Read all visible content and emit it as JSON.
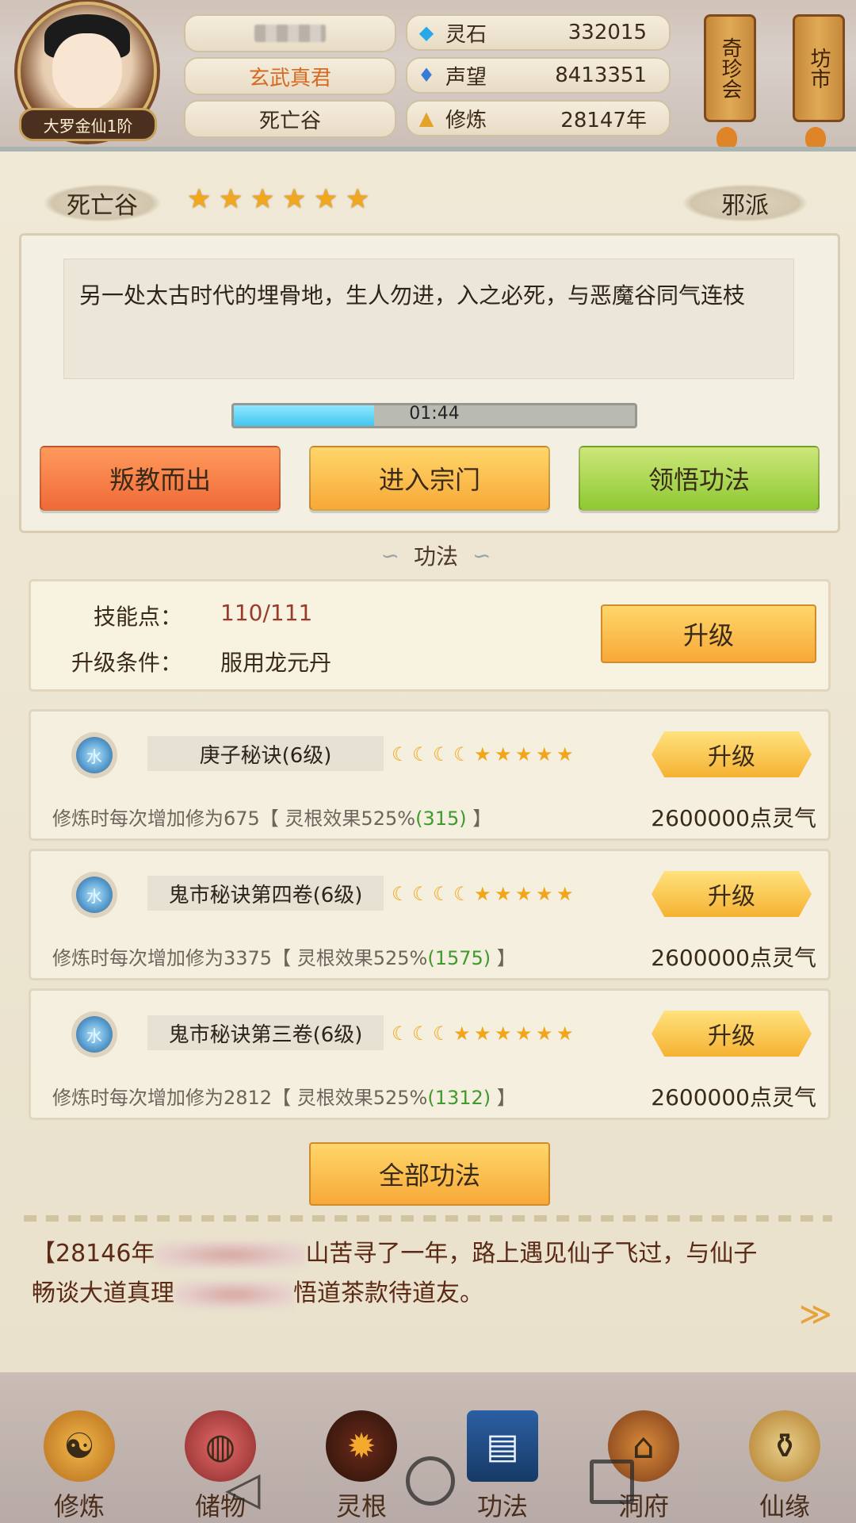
{
  "header": {
    "rank_badge": "大罗金仙1阶",
    "title": "玄武真君",
    "sect": "死亡谷",
    "resources": [
      {
        "icon": "spirit-stone-icon",
        "label": "灵石",
        "value": "332015"
      },
      {
        "icon": "reputation-crystal-icon",
        "label": "声望",
        "value": "8413351"
      },
      {
        "icon": "meditation-icon",
        "label": "修炼",
        "value": "28147年"
      }
    ],
    "lanterns": [
      {
        "label": "奇珍会"
      },
      {
        "label": "坊市"
      }
    ]
  },
  "sect_info": {
    "name": "死亡谷",
    "stars": 6,
    "alignment": "邪派",
    "description": "另一处太古时代的埋骨地，生人勿进，入之必死，与恶魔谷同气连枝",
    "timer": "01:44",
    "timer_progress": 0.35
  },
  "actions": {
    "leave": "叛教而出",
    "enter": "进入宗门",
    "comprehend": "领悟功法"
  },
  "skills_section": {
    "title": "功法",
    "skill_points_label": "技能点：",
    "skill_points_value": "110/111",
    "condition_label": "升级条件：",
    "condition_value": "服用龙元丹",
    "upgrade": "升级"
  },
  "techniques": [
    {
      "element": "水",
      "name": "庚子秘诀(6级)",
      "moons": 4,
      "stars": 5,
      "upgrade": "升级",
      "desc_prefix": "修炼时每次增加修为675【 灵根效果525%",
      "desc_bonus": "(315)",
      "desc_suffix": " 】",
      "cost": "2600000点灵气"
    },
    {
      "element": "水",
      "name": "鬼市秘诀第四卷(6级)",
      "moons": 4,
      "stars": 5,
      "upgrade": "升级",
      "desc_prefix": "修炼时每次增加修为3375【 灵根效果525%",
      "desc_bonus": "(1575)",
      "desc_suffix": " 】",
      "cost": "2600000点灵气"
    },
    {
      "element": "水",
      "name": "鬼市秘诀第三卷(6级)",
      "moons": 3,
      "stars": 6,
      "upgrade": "升级",
      "desc_prefix": "修炼时每次增加修为2812【 灵根效果525%",
      "desc_bonus": "(1312)",
      "desc_suffix": " 】",
      "cost": "2600000点灵气"
    }
  ],
  "all_techniques_button": "全部功法",
  "event_log": {
    "line1_a": "【28146年",
    "line1_b": "山苦寻了一年，路上遇见仙子飞过，与仙子",
    "line2_a": "畅谈大道真理",
    "line2_b": "悟道茶款待道友。"
  },
  "nav": [
    {
      "label": "修炼",
      "icon": "cultivate-icon"
    },
    {
      "label": "储物",
      "icon": "storage-bag-icon"
    },
    {
      "label": "灵根",
      "icon": "spirit-root-icon"
    },
    {
      "label": "功法",
      "icon": "technique-book-icon"
    },
    {
      "label": "洞府",
      "icon": "cave-palace-icon"
    },
    {
      "label": "仙缘",
      "icon": "gourd-icon"
    }
  ]
}
